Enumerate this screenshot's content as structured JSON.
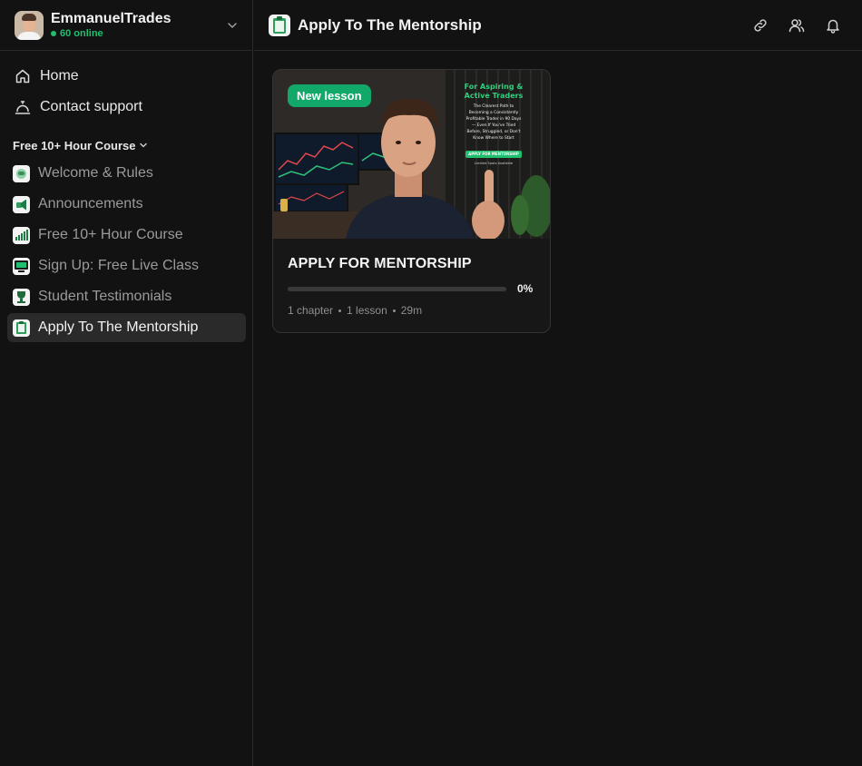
{
  "community": {
    "name": "EmmanuelTrades",
    "online": "60 online"
  },
  "nav": [
    {
      "label": "Home",
      "icon": "home-icon"
    },
    {
      "label": "Contact support",
      "icon": "bell-concierge-icon"
    }
  ],
  "section": {
    "label": "Free 10+ Hour Course"
  },
  "channels": [
    {
      "label": "Welcome & Rules",
      "icon": "handshake-icon",
      "active": false
    },
    {
      "label": "Announcements",
      "icon": "megaphone-icon",
      "active": false
    },
    {
      "label": "Free 10+ Hour Course",
      "icon": "chart-bars-icon",
      "active": false
    },
    {
      "label": "Sign Up: Free Live Class",
      "icon": "monitor-icon",
      "active": false
    },
    {
      "label": "Student Testimonials",
      "icon": "trophy-icon",
      "active": false
    },
    {
      "label": "Apply To The Mentorship",
      "icon": "clipboard-icon",
      "active": true
    }
  ],
  "header": {
    "title": "Apply To The Mentorship",
    "icons": [
      "link-icon",
      "users-icon",
      "bell-icon"
    ]
  },
  "course_card": {
    "badge": "New lesson",
    "title": "APPLY FOR MENTORSHIP",
    "progress": 0,
    "progress_label": "0%",
    "chapters": "1 chapter",
    "lessons": "1 lesson",
    "duration": "29m",
    "thumbnail": {
      "headline_1": "For Aspiring &",
      "headline_2": "Active Traders",
      "body_1": "The Clearest Path to",
      "body_2": "Becoming a Consistently",
      "body_3": "Profitable Trader in 90 Days",
      "body_4": "— Even If You've Tried",
      "body_5": "Before, Struggled, or Don't",
      "body_6": "Know Where to Start",
      "cta": "APPLY FOR MENTORSHIP",
      "footnote": "Limited Spots Available"
    }
  },
  "colors": {
    "accent": "#12a86a",
    "online": "#1fbf6f",
    "background": "#121212",
    "active_item": "#2a2a2a"
  }
}
